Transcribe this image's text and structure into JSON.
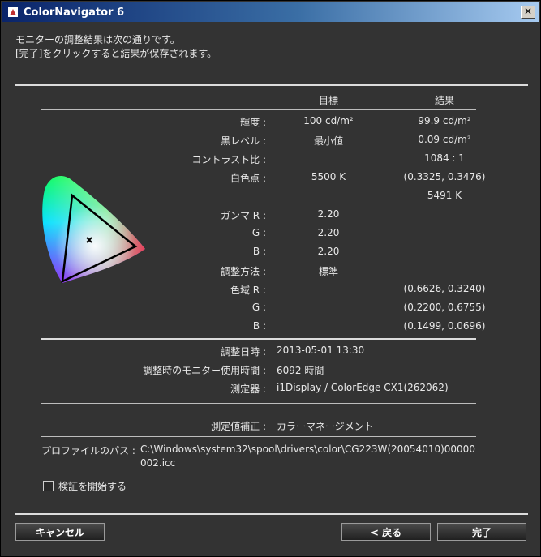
{
  "window": {
    "title": "ColorNavigator 6"
  },
  "message": {
    "line1": "モニターの調整結果は次の通りです。",
    "line2": "[完了]をクリックすると結果が保存されます。"
  },
  "table": {
    "header_target": "目標",
    "header_result": "結果",
    "rows": [
      {
        "label": "輝度 :",
        "target": "100 cd/m²",
        "result": "99.9 cd/m²"
      },
      {
        "label": "黒レベル :",
        "target": "最小値",
        "result": "0.09 cd/m²"
      },
      {
        "label": "コントラスト比 :",
        "target": "",
        "result": "1084 : 1"
      },
      {
        "label": "白色点 :",
        "target": "5500 K",
        "result": "(0.3325, 0.3476)"
      },
      {
        "label": "",
        "target": "",
        "result": "5491 K"
      },
      {
        "label": "ガンマ R :",
        "target": "2.20",
        "result": ""
      },
      {
        "label": "G :",
        "target": "2.20",
        "result": ""
      },
      {
        "label": "B :",
        "target": "2.20",
        "result": ""
      },
      {
        "label": "調整方法 :",
        "target": "標準",
        "result": ""
      },
      {
        "label": "色域 R :",
        "target": "",
        "result": "(0.6626, 0.3240)"
      },
      {
        "label": "G :",
        "target": "",
        "result": "(0.2200, 0.6755)"
      },
      {
        "label": "B :",
        "target": "",
        "result": "(0.1499, 0.0696)"
      }
    ]
  },
  "info": {
    "date_label": "調整日時 :",
    "date_value": "2013-05-01 13:30",
    "hours_label": "調整時のモニター使用時間 :",
    "hours_value": "6092 時間",
    "device_label": "測定器 :",
    "device_value": "i1Display / ColorEdge CX1(262062)",
    "correction_label": "測定値補正 :",
    "correction_value": "カラーマネージメント",
    "profile_label": "プロファイルのパス :",
    "profile_line1": "C:\\Windows\\system32\\spool\\drivers\\color\\CG223W(20054010)00000",
    "profile_line2": "002.icc"
  },
  "checkbox": {
    "label": "検証を開始する",
    "checked": false
  },
  "buttons": {
    "cancel": "キャンセル",
    "back": "< 戻る",
    "finish": "完了"
  }
}
